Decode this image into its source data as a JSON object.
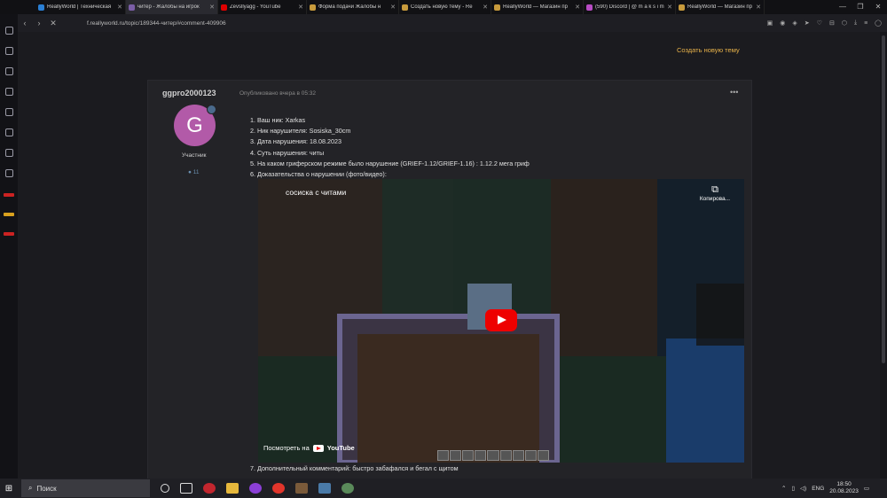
{
  "tabs": [
    {
      "label": "ReallyWorld | Техническая",
      "color": "#2a7fd4",
      "active": false
    },
    {
      "label": "читер - Жалобы на игрок",
      "color": "#7b5ea7",
      "active": true
    },
    {
      "label": "Zevsllyagg - YouTube",
      "color": "#e00000",
      "active": false
    },
    {
      "label": "Форма подачи Жалобы н",
      "color": "#c89b3c",
      "active": false
    },
    {
      "label": "Создать новую тему - Re",
      "color": "#c89b3c",
      "active": false
    },
    {
      "label": "ReallyWorld — Магазин пр",
      "color": "#c89b3c",
      "active": false
    },
    {
      "label": "(590) Discord | @ m a k s i m",
      "color": "#b84cc4",
      "active": false
    },
    {
      "label": "ReallyWorld — Магазин пр",
      "color": "#c89b3c",
      "active": false
    }
  ],
  "address": {
    "url": "f.reallyworld.ru/topic/189344-читер/#comment-409906"
  },
  "page": {
    "create_topic": "Создать новую тему"
  },
  "post": {
    "author": "ggpro2000123",
    "published": "Опубликовано вчера в 05:32",
    "avatar_letter": "G",
    "role": "Участник",
    "comments": "11",
    "lines": [
      "1. Ваш ник: Xarkas",
      "2. Ник нарушителя: Sosiska_30cm",
      "3. Дата нарушения: 18.08.2023",
      "4. Суть нарушения: читы",
      "5. На каком гриферском режиме было нарушение (GRIEF-1.12/GRIEF-1.16) : 1.12.2 мега гриф",
      "6. Доказательства о нарушении (фото/видео):"
    ],
    "comment_line": "7. Дополнительный комментарий: быстро забафался и бегал с щитом"
  },
  "video": {
    "title": "сосиска с читами",
    "copy": "Копирова...",
    "watch_on": "Посмотреть на",
    "youtube": "YouTube"
  },
  "taskbar": {
    "search": "Поиск",
    "lang": "ENG",
    "time": "18:50",
    "date": "20.08.2023"
  }
}
